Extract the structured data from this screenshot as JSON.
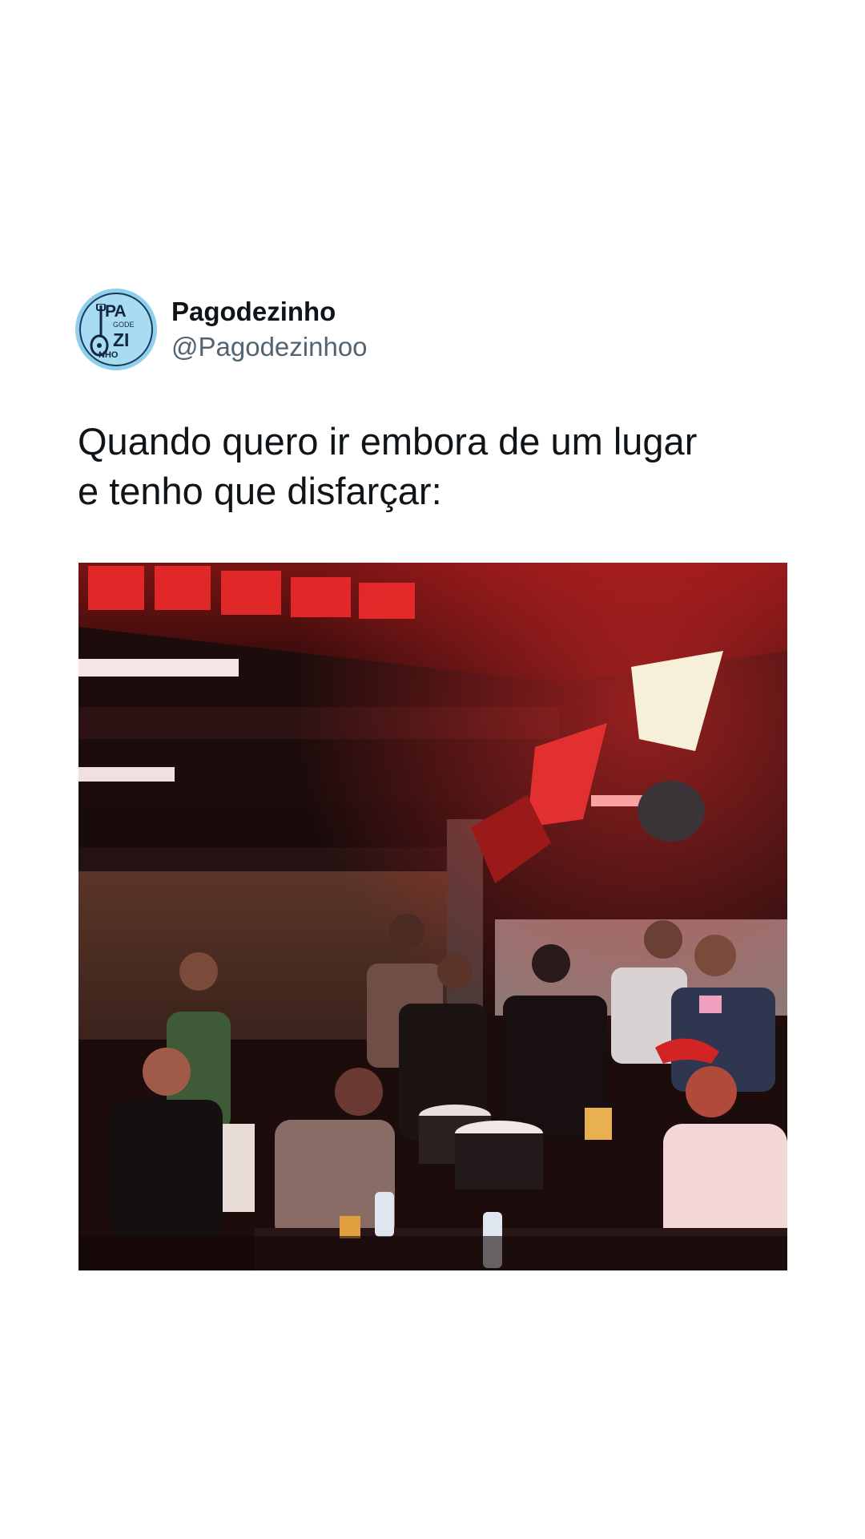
{
  "tweet": {
    "display_name": "Pagodezinho",
    "handle": "@Pagodezinhoo",
    "text_line1": "Quando quero ir embora de um lugar",
    "text_line2": "e tenho que disfarçar:",
    "avatar": {
      "logo_line1": "PA",
      "logo_line2": "GODE",
      "logo_line3": "ZI",
      "logo_line4": "NHO"
    }
  },
  "colors": {
    "background": "#ffffff",
    "text": "#0f1419",
    "secondary_text": "#536471",
    "avatar_bg": "#8fd0ee"
  }
}
